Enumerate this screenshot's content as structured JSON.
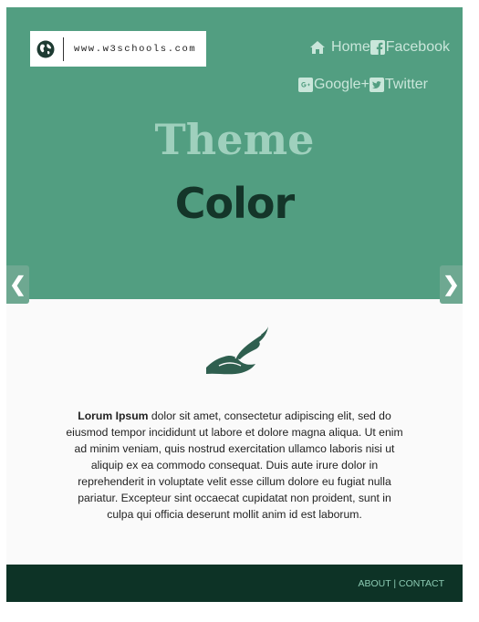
{
  "logo": {
    "text": "www.w3schools.com",
    "icon": "globe-icon"
  },
  "nav": {
    "home": {
      "label": "Home",
      "icon": "home-icon"
    },
    "facebook": {
      "label": "Facebook",
      "icon": "facebook-icon"
    },
    "google": {
      "label": "Google+",
      "icon": "google-plus-icon"
    },
    "twitter": {
      "label": "Twitter",
      "icon": "twitter-icon"
    }
  },
  "hero": {
    "line1": "Theme",
    "line2": "Color",
    "prev_label": "❮",
    "next_label": "❯"
  },
  "content": {
    "lead": "Lorum Ipsum",
    "body": " dolor sit amet, consectetur adipiscing elit, sed do eiusmod tempor incididunt ut labore et dolore magna aliqua. Ut enim ad minim veniam, quis nostrud exercitation ullamco laboris nisi ut aliquip ex ea commodo consequat. Duis aute irure dolor in reprehenderit in voluptate velit esse cillum dolore eu fugiat nulla pariatur. Excepteur sint occaecat cupidatat non proident, sunt in culpa qui officia deserunt mollit anim id est laborum.",
    "icon": "feather-hat-icon"
  },
  "footer": {
    "about": "ABOUT",
    "separator": "|",
    "contact": "CONTACT"
  },
  "colors": {
    "hero_bg": "#529e81",
    "footer_bg": "#0d3326",
    "accent_dark": "#143529",
    "accent_light": "#9fd0bd"
  }
}
